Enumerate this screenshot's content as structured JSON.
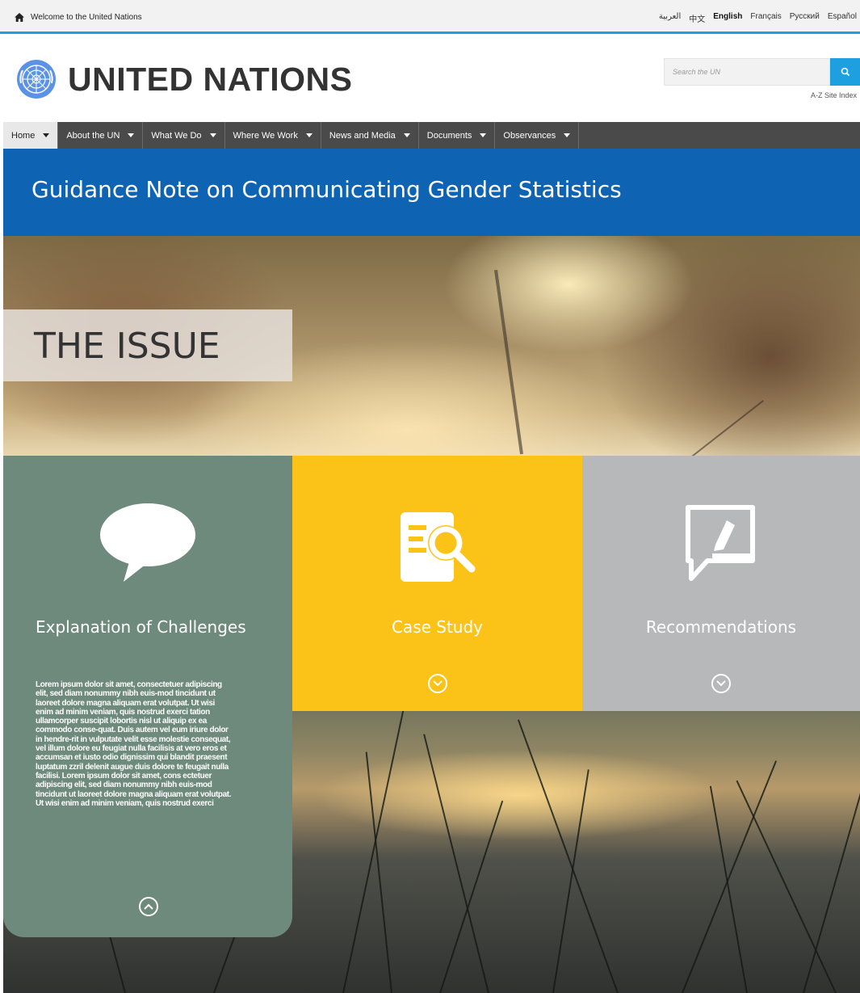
{
  "topbar": {
    "welcome": "Welcome to the United Nations",
    "languages": [
      "العربية",
      "中文",
      "English",
      "Français",
      "Русский",
      "Español"
    ],
    "active_language": "English"
  },
  "header": {
    "title": "UNITED NATIONS",
    "search_placeholder": "Search the UN",
    "az_index": "A-Z Site Index"
  },
  "nav": {
    "items": [
      "Home",
      "About the UN",
      "What We Do",
      "Where We Work",
      "News and Media",
      "Documents",
      "Observances"
    ]
  },
  "page": {
    "title": "Guidance Note on Communicating Gender Statistics",
    "hero_heading": "THE ISSUE"
  },
  "tiles": [
    {
      "label": "Explanation of Challenges",
      "icon": "speech-bubble-icon",
      "color": "#6e8a7c",
      "body": "Lorem ipsum dolor sit amet, consectetuer adipiscing elit, sed diam nonummy nibh euis-mod tincidunt ut laoreet dolore magna aliquam erat volutpat. Ut wisi enim ad minim veniam, quis nostrud exerci tation ullamcorper suscipit lobortis nisl ut aliquip ex ea commodo conse-quat. Duis autem vel eum iriure dolor in hendre-rit in vulputate velit esse molestie consequat, vel illum dolore eu feugiat nulla facilisis at vero eros et accumsan et iusto odio dignissim qui blandit praesent luptatum zzril delenit augue duis dolore te feugait nulla facilisi. Lorem ipsum dolor sit amet, cons ectetuer adipiscing elit, sed diam nonummy nibh euis-mod tincidunt ut laoreet dolore magna aliquam erat volutpat. Ut wisi enim ad minim veniam, quis nostrud exerci"
    },
    {
      "label": "Case Study",
      "icon": "document-search-icon",
      "color": "#fbc317"
    },
    {
      "label": "Recommendations",
      "icon": "edit-note-icon",
      "color": "#b7b8ba"
    }
  ],
  "colors": {
    "accent": "#1e9fe0",
    "title_band": "#0e63b3",
    "nav": "#4a4a4a"
  }
}
